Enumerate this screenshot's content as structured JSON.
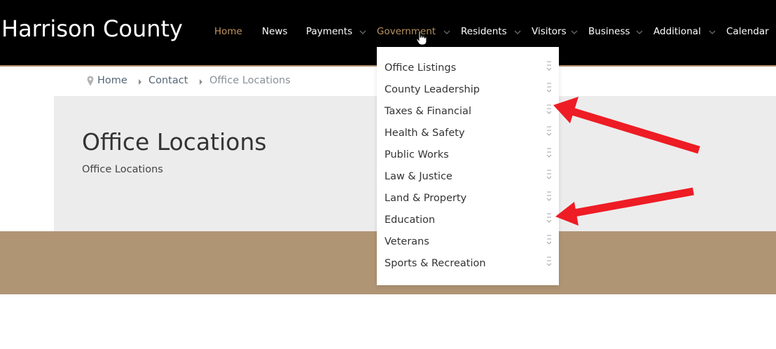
{
  "site": {
    "title": "Harrison County"
  },
  "nav": {
    "items": [
      {
        "label": "Home",
        "state": "active"
      },
      {
        "label": "News"
      },
      {
        "label": "Payments",
        "has_submenu": true
      },
      {
        "label": "Government",
        "has_submenu": true,
        "state": "open"
      },
      {
        "label": "Residents",
        "has_submenu": true
      },
      {
        "label": "Visitors",
        "has_submenu": true
      },
      {
        "label": "Business",
        "has_submenu": true
      },
      {
        "label": "Additional",
        "has_submenu": true
      },
      {
        "label": "Calendar"
      }
    ]
  },
  "dropdown": {
    "parent": "Government",
    "items": [
      {
        "label": "Office Listings"
      },
      {
        "label": "County Leadership"
      },
      {
        "label": "Taxes & Financial"
      },
      {
        "label": "Health & Safety"
      },
      {
        "label": "Public Works"
      },
      {
        "label": "Law & Justice"
      },
      {
        "label": "Land & Property"
      },
      {
        "label": "Education"
      },
      {
        "label": "Veterans"
      },
      {
        "label": "Sports & Recreation"
      }
    ]
  },
  "breadcrumb": {
    "items": [
      {
        "label": "Home",
        "icon": "map-pin-icon"
      },
      {
        "label": "Contact"
      },
      {
        "label": "Office Locations",
        "current": true
      }
    ]
  },
  "page": {
    "title": "Office Locations",
    "subtitle": "Office Locations"
  },
  "annotations": {
    "arrows": [
      {
        "points_to": "Taxes & Financial",
        "color": "#ee1c24"
      },
      {
        "points_to": "Education",
        "color": "#ee1c24"
      }
    ]
  },
  "colors": {
    "header_bg": "#000000",
    "accent": "#c2955f",
    "tan_band": "#b09575",
    "title_panel": "#ececec",
    "arrow": "#ee1c24"
  }
}
